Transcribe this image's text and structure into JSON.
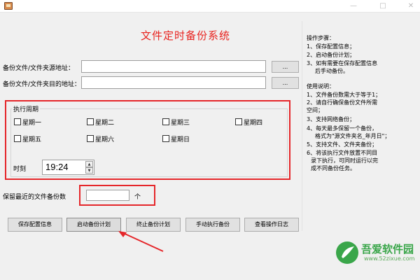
{
  "window": {
    "app_title": "文件定时备份系统",
    "controls": {
      "minimize": "—",
      "maximize": "□",
      "close": "✕"
    }
  },
  "form": {
    "source_label": "备份文件/文件夹源地址：",
    "source_value": "",
    "source_browse": "...",
    "dest_label": "备份文件/文件夹目的地址：",
    "dest_value": "",
    "dest_browse": "..."
  },
  "schedule": {
    "group_title": "执行周期",
    "days": [
      {
        "label": "星期一",
        "checked": false
      },
      {
        "label": "星期二",
        "checked": false
      },
      {
        "label": "星期三",
        "checked": false
      },
      {
        "label": "星期四",
        "checked": false
      },
      {
        "label": "星期五",
        "checked": false
      },
      {
        "label": "星期六",
        "checked": false
      },
      {
        "label": "星期日",
        "checked": false
      }
    ],
    "time_label": "时刻",
    "time_value": "19:24"
  },
  "retention": {
    "label": "保留最近的文件备份数",
    "value": "",
    "unit": "个"
  },
  "actions": {
    "save_config": "保存配置信息",
    "start_plan": "启动备份计划",
    "stop_plan": "终止备份计划",
    "manual_backup": "手动执行备份",
    "view_log": "查看操作日志"
  },
  "instructions": {
    "steps_title": "操作步骤：",
    "steps": [
      "1、保存配置信息；",
      "2、启动备份计划；",
      "3、如有需要在保存配置信息",
      "后手动备份。"
    ],
    "notes_title": "使用说明：",
    "notes": [
      "1、文件备份数需大于等于1；",
      "2、请自行确保备份文件所需",
      "空间；",
      "3、支持网络备份；",
      "4、每天最多保留一个备份，",
      "格式为\"源文件夹名_年月日\"；",
      "5、支持文件、文件夹备份；",
      "6、将该执行文件放置不同目",
      "录下执行，可同时运行以完",
      "成不同备份任务。"
    ]
  },
  "watermark": {
    "name": "吾爱软件园",
    "url": "www.52zixue.com"
  },
  "colors": {
    "title_red": "#e8231f",
    "annotation_red": "#e5262a",
    "watermark_green": "#3aa64a"
  }
}
